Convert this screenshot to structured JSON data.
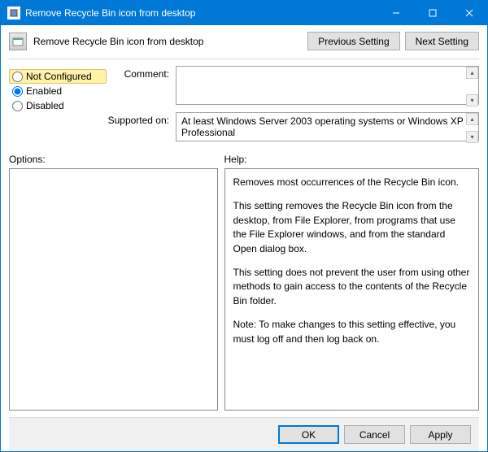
{
  "window": {
    "title": "Remove Recycle Bin icon from desktop"
  },
  "header": {
    "policy_title": "Remove Recycle Bin icon from desktop",
    "previous_label": "Previous Setting",
    "next_label": "Next Setting"
  },
  "radios": {
    "not_configured": "Not Configured",
    "enabled": "Enabled",
    "disabled": "Disabled",
    "selected": "enabled"
  },
  "fields": {
    "comment_label": "Comment:",
    "comment_value": "",
    "supported_label": "Supported on:",
    "supported_value": "At least Windows Server 2003 operating systems or Windows XP Professional"
  },
  "panes": {
    "options_label": "Options:",
    "help_label": "Help:",
    "help_paragraphs": [
      "Removes most occurrences of the Recycle Bin icon.",
      "This setting removes the Recycle Bin icon from the desktop, from File Explorer, from programs that use the File Explorer windows, and from the standard Open dialog box.",
      "This setting does not prevent the user from using other methods to gain access to the contents of the Recycle Bin folder.",
      "Note: To make changes to this setting effective, you must log off and then log back on."
    ]
  },
  "footer": {
    "ok": "OK",
    "cancel": "Cancel",
    "apply": "Apply"
  }
}
